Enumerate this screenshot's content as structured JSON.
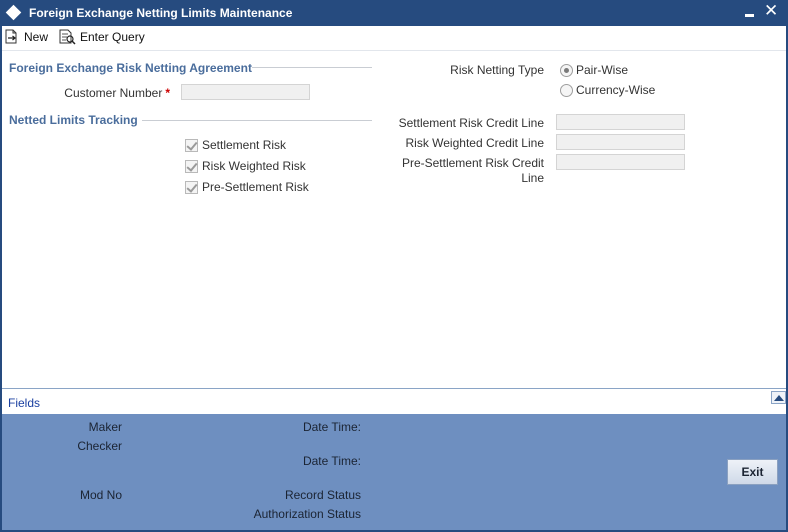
{
  "window": {
    "title": "Foreign Exchange Netting Limits Maintenance"
  },
  "toolbar": {
    "new_label": "New",
    "enter_query_label": "Enter Query"
  },
  "agreement_section": {
    "title": "Foreign Exchange Risk Netting Agreement",
    "customer_number_label": "Customer Number",
    "required_mark": "*",
    "customer_number_value": ""
  },
  "risk_netting_type": {
    "label": "Risk Netting Type",
    "options": [
      "Pair-Wise",
      "Currency-Wise"
    ],
    "selected": "Pair-Wise"
  },
  "netted_limits_section": {
    "title": "Netted Limits Tracking",
    "checkboxes": [
      {
        "label": "Settlement Risk",
        "checked": true
      },
      {
        "label": "Risk Weighted Risk",
        "checked": true
      },
      {
        "label": "Pre-Settlement Risk",
        "checked": true
      }
    ]
  },
  "credit_lines": [
    {
      "label": "Settlement Risk Credit Line",
      "value": ""
    },
    {
      "label": "Risk Weighted Credit Line",
      "value": ""
    },
    {
      "label_line1": "Pre-Settlement Risk Credit",
      "label_line2": "Line",
      "value": ""
    }
  ],
  "fields_bar": {
    "label": "Fields"
  },
  "audit": {
    "maker_label": "Maker",
    "checker_label": "Checker",
    "mod_no_label": "Mod No",
    "date_time_label_1": "Date Time:",
    "date_time_label_2": "Date Time:",
    "record_status_label": "Record Status",
    "authorization_status_label": "Authorization Status",
    "exit_label": "Exit"
  },
  "colors": {
    "title_bar": "#264b7f",
    "section_title": "#4a6d9c",
    "audit_panel": "#6e8fc0",
    "link": "#1a3fa0",
    "required": "#cc0000"
  },
  "icons": [
    "diamond-icon",
    "minimize-icon",
    "close-icon",
    "new-document-icon",
    "enter-query-icon",
    "collapse-arrow-icon"
  ]
}
